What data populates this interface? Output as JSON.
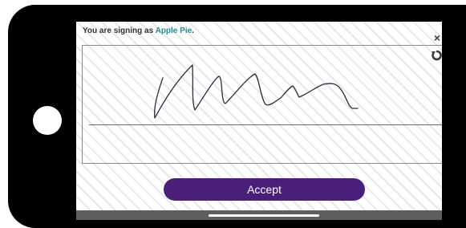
{
  "header": {
    "prefix": "You are signing as",
    "signer_name": "Apple Pie",
    "suffix": "."
  },
  "controls": {
    "close_label": "×"
  },
  "accept_button": {
    "label": "Accept"
  },
  "colors": {
    "accent_name": "#2a8a86",
    "accept_button_bg": "#4a1f7a",
    "device_frame": "#000000"
  }
}
